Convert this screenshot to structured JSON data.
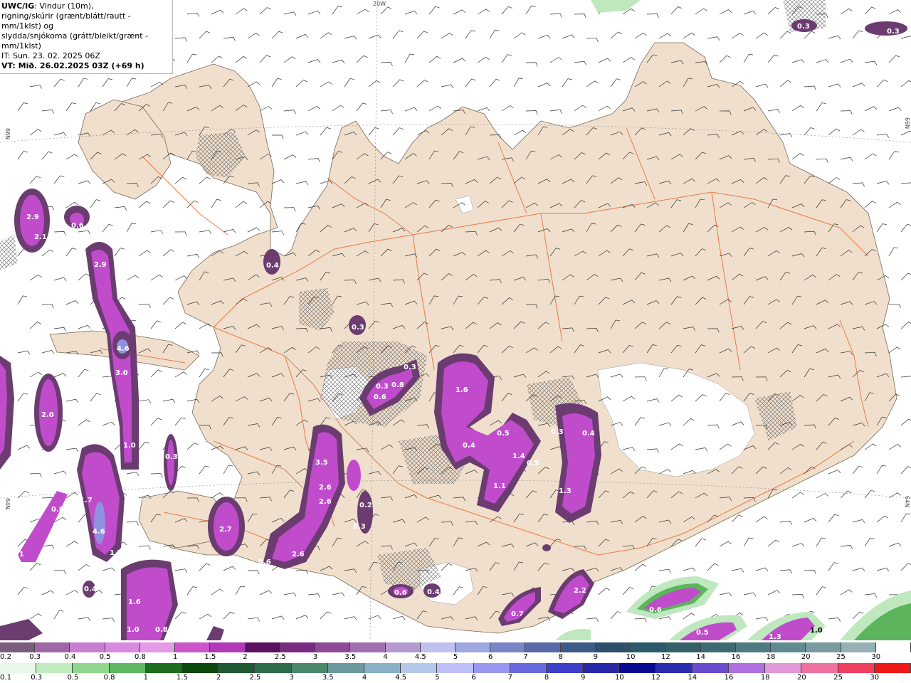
{
  "header": {
    "title": "UWC/IG",
    "line1_rest": ": Vindur (10m),",
    "line2": "rigning/skúrir (grænt/blátt/rautt - mm/1klst) og",
    "line3": "slydda/snjókoma (grátt/bleikt/grænt - mm/1klst)",
    "line4": "IT: Sun. 23. 02. 2025 06Z",
    "line5": "VT: Mið. 26.02.2025 03Z (+69 h)"
  },
  "grid_labels": {
    "top": "20W",
    "left_upper": "66N",
    "left_lower": "64N",
    "right_upper": "66N",
    "right_lower": "64N"
  },
  "colors": {
    "land": "#f0dfcc",
    "roads": "#e8703a",
    "snow_light": "#dca0e0",
    "snow_mid": "#c04ccc",
    "snow_dark": "#6a3c70",
    "rain_light": "#bfe8bf",
    "rain_mid": "#5cb45c"
  },
  "precip_labels": [
    "0.3",
    "0.3",
    "2.9",
    "2.1",
    "0.6",
    "2.9",
    "0.4",
    "0.3",
    "4.6",
    "3.0",
    "2.0",
    "1.0",
    "0.3",
    "1.7",
    "4.6",
    "1.7",
    "1.1",
    "1.6",
    "1.0",
    "0.8",
    "0.4",
    "0.3",
    "0.6",
    "0.8",
    "0.3",
    "1.6",
    "0.5",
    "0.4",
    "1.4",
    "0.5",
    "0.3",
    "0.4",
    "1.1",
    "1.3",
    "3.5",
    "2.6",
    "2.6",
    "2.7",
    "0.6",
    "2.6",
    "0.2",
    "0.3",
    "0.6",
    "0.4",
    "0.7",
    "2.2",
    "0.6",
    "0.5",
    "1.3",
    "1.0",
    "0.8"
  ],
  "legend_top": {
    "labels": [
      "0.2",
      "0.3",
      "0.4",
      "0.5",
      "0.8",
      "1",
      "1.5",
      "2",
      "2.5",
      "3",
      "3.5",
      "4",
      "4.5",
      "5",
      "6",
      "7",
      "8",
      "9",
      "10",
      "12",
      "14",
      "16",
      "18",
      "20",
      "25",
      "30"
    ],
    "colors": [
      "#7c5c7c",
      "#a067a8",
      "#c77fd0",
      "#d98ae0",
      "#e59ae8",
      "#cc55cc",
      "#b23ab8",
      "#5c1060",
      "#7a2a80",
      "#8e4a98",
      "#a070b0",
      "#b49ad0",
      "#c0c0f0",
      "#a0a8e0",
      "#7a84c8",
      "#5a6aa8",
      "#3c5a88",
      "#2e4e6e",
      "#2a5a6a",
      "#34606a",
      "#3e6a74",
      "#4e7a82",
      "#5e8a90",
      "#7a9ca0",
      "#96b0b4",
      "#ffffff"
    ]
  },
  "legend_bottom": {
    "labels": [
      "0.1",
      "0.3",
      "0.5",
      "0.8",
      "1",
      "1.5",
      "2",
      "2.5",
      "3",
      "3.5",
      "4",
      "4.5",
      "5",
      "6",
      "7",
      "8",
      "9",
      "10",
      "12",
      "14",
      "16",
      "18",
      "20",
      "25",
      "30"
    ],
    "colors": [
      "#e8f8e8",
      "#c0ecc0",
      "#90d890",
      "#60b860",
      "#1e6e1e",
      "#0e4a0e",
      "#1e5a32",
      "#2e6e4a",
      "#4a8a6a",
      "#6a9aa0",
      "#8ab0c8",
      "#b4c8ec",
      "#c0c0f8",
      "#9898f0",
      "#6a6ae0",
      "#3e3ec8",
      "#2828a8",
      "#0a0a90",
      "#2c2cb0",
      "#6a4ad0",
      "#b070e0",
      "#e098d8",
      "#f070a0",
      "#f04060",
      "#f01818"
    ]
  }
}
